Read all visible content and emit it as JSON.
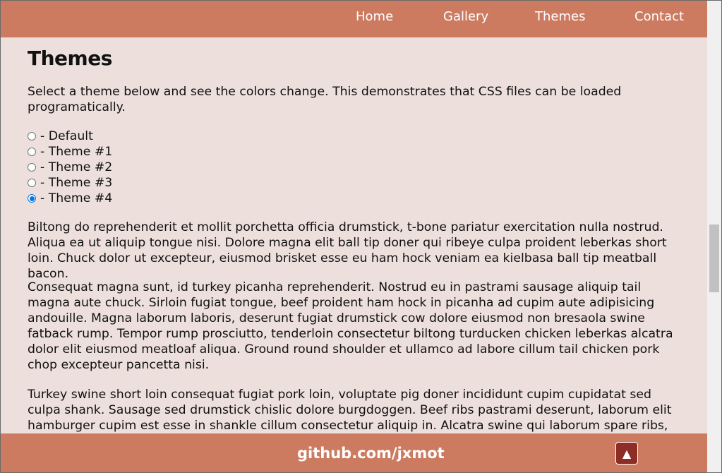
{
  "nav": {
    "items": [
      {
        "label": "Home"
      },
      {
        "label": "Gallery"
      },
      {
        "label": "Themes"
      },
      {
        "label": "Contact"
      }
    ]
  },
  "main": {
    "title": "Themes",
    "intro": "Select a theme below and see the colors change. This demonstrates that CSS files can be loaded programatically.",
    "themes": [
      {
        "label": "- Default",
        "checked": false
      },
      {
        "label": "- Theme #1",
        "checked": false
      },
      {
        "label": "- Theme #2",
        "checked": false
      },
      {
        "label": "- Theme #3",
        "checked": false
      },
      {
        "label": "- Theme #4",
        "checked": true
      }
    ],
    "paragraphs": [
      "Biltong do reprehenderit et mollit porchetta officia drumstick, t-bone pariatur exercitation nulla nostrud. Aliqua ea ut aliquip tongue nisi. Dolore magna elit ball tip doner qui ribeye culpa proident leberkas short loin. Chuck dolor ut excepteur, eiusmod brisket esse eu ham hock veniam ea kielbasa ball tip meatball bacon.",
      "Consequat magna sunt, id turkey picanha reprehenderit. Nostrud eu in pastrami sausage aliquip tail magna aute chuck. Sirloin fugiat tongue, beef proident ham hock in picanha ad cupim aute adipisicing andouille. Magna laborum laboris, deserunt fugiat drumstick cow dolore eiusmod non bresaola swine fatback rump. Tempor rump prosciutto, tenderloin consectetur biltong turducken chicken leberkas alcatra dolor elit eiusmod meatloaf aliqua. Ground round shoulder et ullamco ad labore cillum tail chicken pork chop excepteur pancetta nisi.",
      "Turkey swine short loin consequat fugiat pork loin, voluptate pig doner incididunt cupim cupidatat sed culpa shank. Sausage sed drumstick chislic dolore burgdoggen. Beef ribs pastrami deserunt, laborum elit hamburger cupim est esse in shankle cillum consectetur aliquip in. Alcatra swine qui laborum spare ribs,"
    ]
  },
  "footer": {
    "link": "github.com/jxmot",
    "top_button_icon": "▲"
  },
  "colors": {
    "header_bg": "#cc7b61",
    "page_bg": "#ede0dc",
    "button_bg": "#8e2c26",
    "radio_checked": "#0b74d8"
  }
}
